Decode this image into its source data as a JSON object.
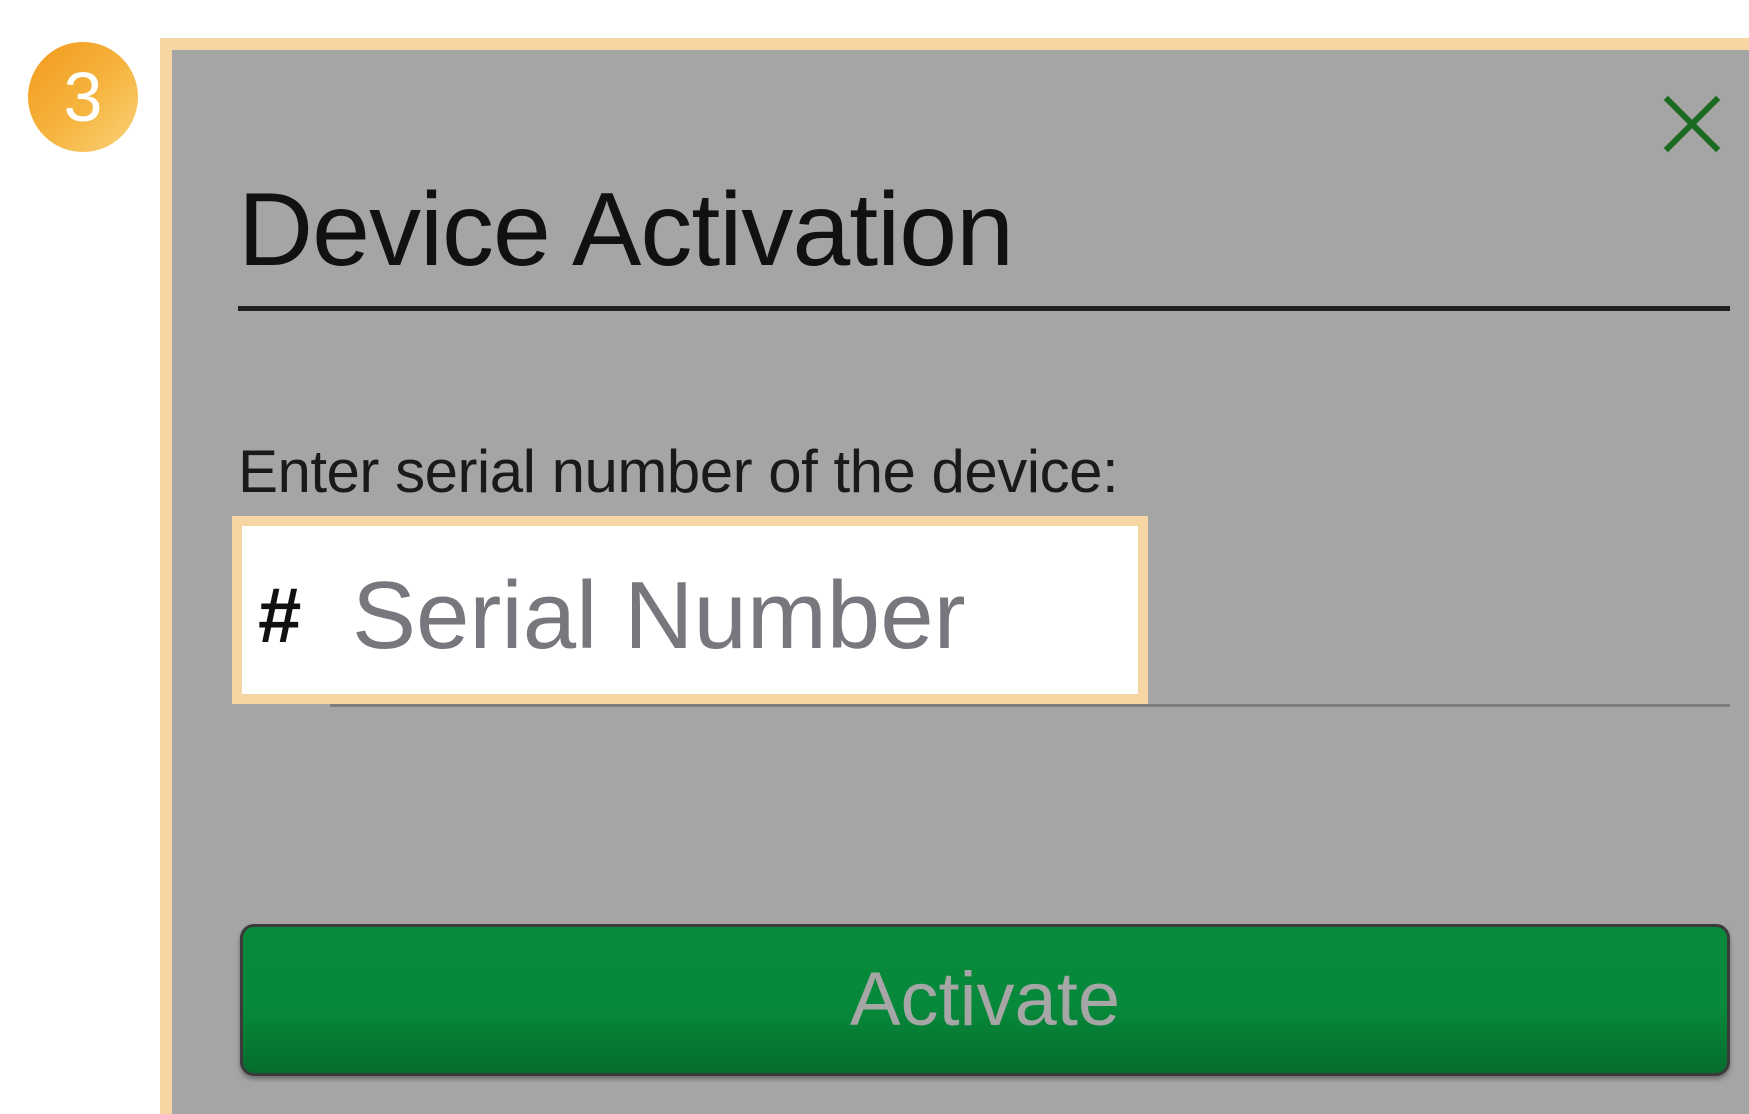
{
  "step_badge": {
    "number": "3",
    "color": "#f4a83a"
  },
  "dialog": {
    "title": "Device Activation",
    "close_icon": "close-icon",
    "prompt": "Enter serial number of the device:",
    "serial_field": {
      "prefix_icon": "hash-icon",
      "prefix": "#",
      "placeholder": "Serial Number",
      "value": ""
    },
    "activate_label": "Activate"
  },
  "colors": {
    "dialog_background": "#a5a5a5",
    "highlight_border": "#f7d6a3",
    "button_green": "#07863a",
    "close_icon": "#1b6b22"
  }
}
